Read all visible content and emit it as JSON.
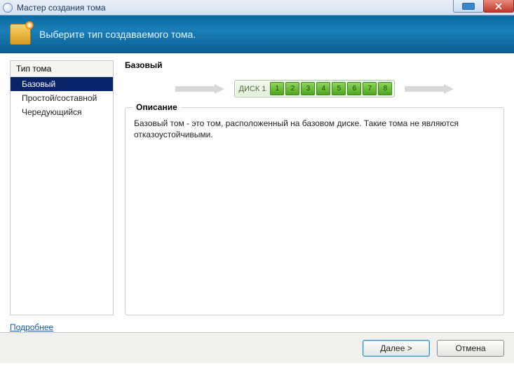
{
  "window": {
    "title": "Мастер создания тома"
  },
  "banner": {
    "caption": "Выберите тип создаваемого тома."
  },
  "sidebar": {
    "header": "Тип тома",
    "items": [
      {
        "label": "Базовый",
        "selected": true
      },
      {
        "label": "Простой/составной",
        "selected": false
      },
      {
        "label": "Чередующийся",
        "selected": false
      }
    ]
  },
  "main": {
    "heading": "Базовый",
    "disk_label": "ДИСК 1",
    "disk_segments": [
      "1",
      "2",
      "3",
      "4",
      "5",
      "6",
      "7",
      "8"
    ],
    "groupbox_title": "Описание",
    "description": "Базовый том - это том, расположенный на базовом диске. Такие тома не являются отказоустойчивыми."
  },
  "link": {
    "more": "Подробнее"
  },
  "footer": {
    "next": "Далее >",
    "cancel": "Отмена"
  }
}
